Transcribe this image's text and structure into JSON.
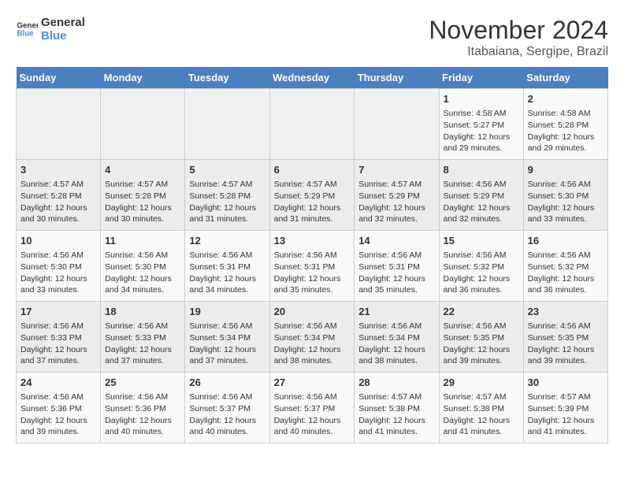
{
  "logo": {
    "text_general": "General",
    "text_blue": "Blue"
  },
  "title": "November 2024",
  "subtitle": "Itabaiana, Sergipe, Brazil",
  "days_of_week": [
    "Sunday",
    "Monday",
    "Tuesday",
    "Wednesday",
    "Thursday",
    "Friday",
    "Saturday"
  ],
  "weeks": [
    [
      {
        "day": "",
        "content": ""
      },
      {
        "day": "",
        "content": ""
      },
      {
        "day": "",
        "content": ""
      },
      {
        "day": "",
        "content": ""
      },
      {
        "day": "",
        "content": ""
      },
      {
        "day": "1",
        "content": "Sunrise: 4:58 AM\nSunset: 5:27 PM\nDaylight: 12 hours and 29 minutes."
      },
      {
        "day": "2",
        "content": "Sunrise: 4:58 AM\nSunset: 5:28 PM\nDaylight: 12 hours and 29 minutes."
      }
    ],
    [
      {
        "day": "3",
        "content": "Sunrise: 4:57 AM\nSunset: 5:28 PM\nDaylight: 12 hours and 30 minutes."
      },
      {
        "day": "4",
        "content": "Sunrise: 4:57 AM\nSunset: 5:28 PM\nDaylight: 12 hours and 30 minutes."
      },
      {
        "day": "5",
        "content": "Sunrise: 4:57 AM\nSunset: 5:28 PM\nDaylight: 12 hours and 31 minutes."
      },
      {
        "day": "6",
        "content": "Sunrise: 4:57 AM\nSunset: 5:29 PM\nDaylight: 12 hours and 31 minutes."
      },
      {
        "day": "7",
        "content": "Sunrise: 4:57 AM\nSunset: 5:29 PM\nDaylight: 12 hours and 32 minutes."
      },
      {
        "day": "8",
        "content": "Sunrise: 4:56 AM\nSunset: 5:29 PM\nDaylight: 12 hours and 32 minutes."
      },
      {
        "day": "9",
        "content": "Sunrise: 4:56 AM\nSunset: 5:30 PM\nDaylight: 12 hours and 33 minutes."
      }
    ],
    [
      {
        "day": "10",
        "content": "Sunrise: 4:56 AM\nSunset: 5:30 PM\nDaylight: 12 hours and 33 minutes."
      },
      {
        "day": "11",
        "content": "Sunrise: 4:56 AM\nSunset: 5:30 PM\nDaylight: 12 hours and 34 minutes."
      },
      {
        "day": "12",
        "content": "Sunrise: 4:56 AM\nSunset: 5:31 PM\nDaylight: 12 hours and 34 minutes."
      },
      {
        "day": "13",
        "content": "Sunrise: 4:56 AM\nSunset: 5:31 PM\nDaylight: 12 hours and 35 minutes."
      },
      {
        "day": "14",
        "content": "Sunrise: 4:56 AM\nSunset: 5:31 PM\nDaylight: 12 hours and 35 minutes."
      },
      {
        "day": "15",
        "content": "Sunrise: 4:56 AM\nSunset: 5:32 PM\nDaylight: 12 hours and 36 minutes."
      },
      {
        "day": "16",
        "content": "Sunrise: 4:56 AM\nSunset: 5:32 PM\nDaylight: 12 hours and 36 minutes."
      }
    ],
    [
      {
        "day": "17",
        "content": "Sunrise: 4:56 AM\nSunset: 5:33 PM\nDaylight: 12 hours and 37 minutes."
      },
      {
        "day": "18",
        "content": "Sunrise: 4:56 AM\nSunset: 5:33 PM\nDaylight: 12 hours and 37 minutes."
      },
      {
        "day": "19",
        "content": "Sunrise: 4:56 AM\nSunset: 5:34 PM\nDaylight: 12 hours and 37 minutes."
      },
      {
        "day": "20",
        "content": "Sunrise: 4:56 AM\nSunset: 5:34 PM\nDaylight: 12 hours and 38 minutes."
      },
      {
        "day": "21",
        "content": "Sunrise: 4:56 AM\nSunset: 5:34 PM\nDaylight: 12 hours and 38 minutes."
      },
      {
        "day": "22",
        "content": "Sunrise: 4:56 AM\nSunset: 5:35 PM\nDaylight: 12 hours and 39 minutes."
      },
      {
        "day": "23",
        "content": "Sunrise: 4:56 AM\nSunset: 5:35 PM\nDaylight: 12 hours and 39 minutes."
      }
    ],
    [
      {
        "day": "24",
        "content": "Sunrise: 4:56 AM\nSunset: 5:36 PM\nDaylight: 12 hours and 39 minutes."
      },
      {
        "day": "25",
        "content": "Sunrise: 4:56 AM\nSunset: 5:36 PM\nDaylight: 12 hours and 40 minutes."
      },
      {
        "day": "26",
        "content": "Sunrise: 4:56 AM\nSunset: 5:37 PM\nDaylight: 12 hours and 40 minutes."
      },
      {
        "day": "27",
        "content": "Sunrise: 4:56 AM\nSunset: 5:37 PM\nDaylight: 12 hours and 40 minutes."
      },
      {
        "day": "28",
        "content": "Sunrise: 4:57 AM\nSunset: 5:38 PM\nDaylight: 12 hours and 41 minutes."
      },
      {
        "day": "29",
        "content": "Sunrise: 4:57 AM\nSunset: 5:38 PM\nDaylight: 12 hours and 41 minutes."
      },
      {
        "day": "30",
        "content": "Sunrise: 4:57 AM\nSunset: 5:39 PM\nDaylight: 12 hours and 41 minutes."
      }
    ]
  ]
}
